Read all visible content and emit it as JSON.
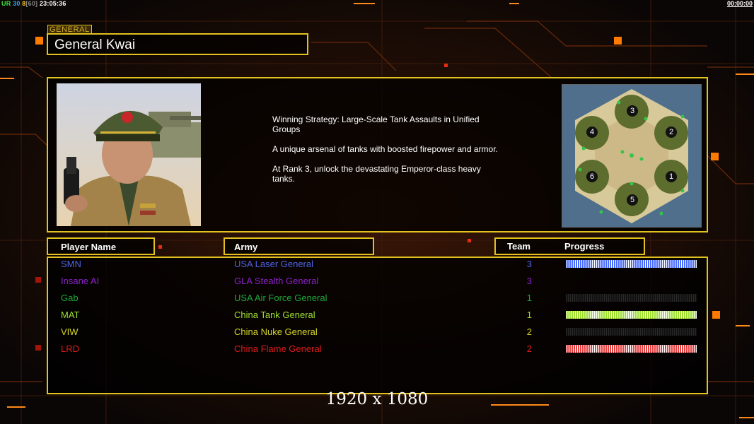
{
  "hud": {
    "mode": "UR",
    "fps": "30",
    "fps_a": "8",
    "fps_b": "[60]",
    "clock": "23:05:36",
    "timer": "00:00:00"
  },
  "general": {
    "tag": "GENERAL",
    "name": "General Kwai",
    "description": [
      "Winning Strategy: Large-Scale Tank Assaults in Unified Groups",
      "A unique arsenal of tanks with boosted firepower and armor.",
      "At Rank 3, unlock the devastating Emperor-class heavy tanks."
    ]
  },
  "map": {
    "bases": [
      {
        "label": "3"
      },
      {
        "label": "4"
      },
      {
        "label": "2"
      },
      {
        "label": "6"
      },
      {
        "label": "1"
      },
      {
        "label": "5"
      }
    ]
  },
  "headers": {
    "player_name": "Player Name",
    "army": "Army",
    "team": "Team",
    "progress": "Progress"
  },
  "players": [
    {
      "name": "SMN",
      "army": "USA Laser General",
      "team": "3",
      "color": "#4f63e4",
      "progress": 1.0,
      "bar_color": "#4a6cff"
    },
    {
      "name": "Insane AI",
      "army": "GLA Stealth General",
      "team": "3",
      "color": "#8a22c9",
      "progress": null,
      "bar_color": "#8a22c9"
    },
    {
      "name": "Gab",
      "army": "USA Air Force General",
      "team": "1",
      "color": "#1fa83a",
      "progress": 0.0,
      "bar_color": "#1fa83a"
    },
    {
      "name": "MAT",
      "army": "China Tank General",
      "team": "1",
      "color": "#9ee030",
      "progress": 1.0,
      "bar_color": "#9ee030"
    },
    {
      "name": "VIW",
      "army": "China Nuke General",
      "team": "2",
      "color": "#d6d628",
      "progress": 0.0,
      "bar_color": "#d6d628"
    },
    {
      "name": "LRD",
      "army": "China Flame General",
      "team": "2",
      "color": "#e01b1b",
      "progress": 1.0,
      "bar_color": "#e64040"
    }
  ],
  "resolution": "1920 x 1080"
}
